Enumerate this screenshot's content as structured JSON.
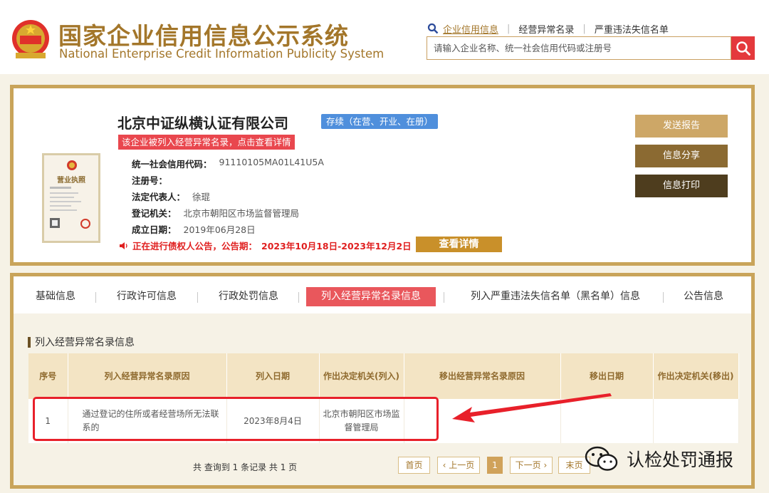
{
  "header": {
    "title_cn": "国家企业信用信息公示系统",
    "title_en": "National Enterprise Credit Information Publicity System",
    "links": [
      "企业信用信息",
      "经营异常名录",
      "严重违法失信名单"
    ],
    "search_placeholder": "请输入企业名称、统一社会信用代码或注册号"
  },
  "company": {
    "name": "北京中证纵横认证有限公司",
    "status": "存续（在营、开业、在册）",
    "warning": "该企业被列入经营异常名录，点击查看详情",
    "license_label": "营业执照",
    "fields": [
      {
        "label": "统一社会信用代码：",
        "value": "91110105MA01L41U5A"
      },
      {
        "label": "注册号：",
        "value": ""
      },
      {
        "label": "法定代表人：",
        "value": "徐琨"
      },
      {
        "label": "登记机关：",
        "value": "北京市朝阳区市场监督管理局"
      },
      {
        "label": "成立日期：",
        "value": "2019年06月28日"
      }
    ],
    "creditor_notice": "正在进行债权人公告，公告期：",
    "creditor_period": "2023年10月18日-2023年12月2日",
    "detail_button": "查看详情",
    "actions": [
      "发送报告",
      "信息分享",
      "信息打印"
    ]
  },
  "tabs": [
    "基础信息",
    "行政许可信息",
    "行政处罚信息",
    "列入经营异常名录信息",
    "列入严重违法失信名单（黑名单）信息",
    "公告信息"
  ],
  "active_tab": 3,
  "section_title": "列入经营异常名录信息",
  "table": {
    "headers": [
      "序号",
      "列入经营异常名录原因",
      "列入日期",
      "作出决定机关(列入)",
      "移出经营异常名录原因",
      "移出日期",
      "作出决定机关(移出)"
    ],
    "rows": [
      [
        "1",
        "通过登记的住所或者经营场所无法联系的",
        "2023年8月4日",
        "北京市朝阳区市场监督管理局",
        "",
        "",
        ""
      ]
    ]
  },
  "pagination": {
    "summary": "共 查询到 1 条记录 共 1 页",
    "first": "首页",
    "prev": "上一页",
    "current": "1",
    "next": "下一页",
    "last": "末页"
  },
  "watermark": "认检处罚通报",
  "colors": {
    "gold": "#a3762a",
    "red": "#e9474e",
    "blue": "#4f8fdc",
    "border": "#c9a45a"
  }
}
